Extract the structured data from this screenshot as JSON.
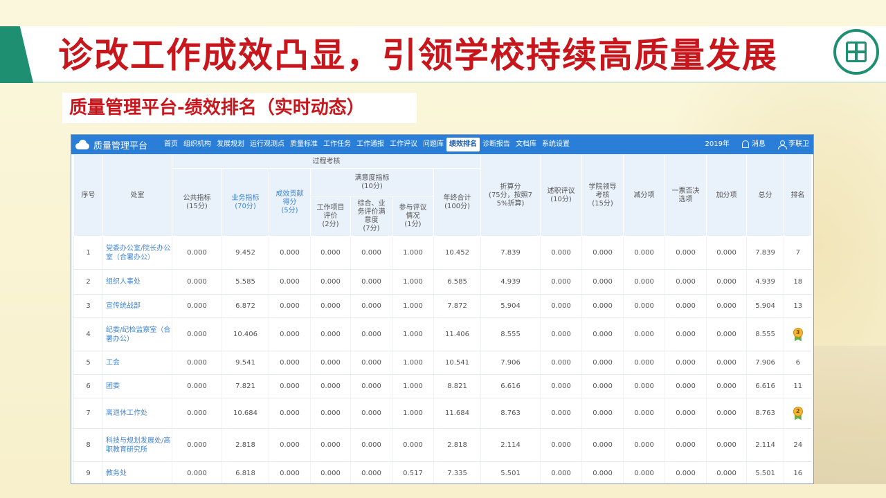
{
  "slide": {
    "title": "诊改工作成效凸显，引领学校持续高质量发展",
    "subtitle": "质量管理平台-绩效排名（实时动态）"
  },
  "app": {
    "brand": "质量管理平台",
    "nav": [
      "首页",
      "组织机构",
      "发展规划",
      "运行观测点",
      "质量标准",
      "工作任务",
      "工作通报",
      "工作评议",
      "问题库",
      "绩效排名",
      "诊断报告",
      "文档库",
      "系统设置"
    ],
    "nav_active": "绩效排名",
    "year": "2019年",
    "messages": "消息",
    "user": "李联卫"
  },
  "table": {
    "headers": {
      "index": "序号",
      "unit": "处室",
      "process": "过程考核",
      "public": "公共指标\n(15分)",
      "business": "业务指标\n(70分)",
      "contribution": "成效贡献\n得分\n(5分)",
      "satisfaction": "满意度指标\n(10分)",
      "sat_project": "工作项目\n评价\n(2分)",
      "sat_overall": "综合、业\n务评价满\n意度\n(7分)",
      "sat_participation": "参与评议\n情况\n(1分)",
      "annual_total": "年终合计\n(100分)",
      "converted": "折算分\n(75分，按照7\n5%折算)",
      "report": "述职评议\n(10分)",
      "leader": "学院领导\n考核\n(15分)",
      "deduction": "减分项",
      "veto": "一票否决\n选项",
      "bonus": "加分项",
      "total": "总分",
      "rank": "排名"
    },
    "rows": [
      {
        "idx": "1",
        "unit": "党委办公室/院长办公室（合署办公）",
        "public": "0.000",
        "business": "9.452",
        "contribution": "0.000",
        "sat_project": "0.000",
        "sat_overall": "0.000",
        "sat_participation": "1.000",
        "annual_total": "10.452",
        "converted": "7.839",
        "report": "0.000",
        "leader": "0.000",
        "deduction": "0.000",
        "veto": "0.000",
        "bonus": "0.000",
        "total": "7.839",
        "rank": "7"
      },
      {
        "idx": "2",
        "unit": "组织人事处",
        "public": "0.000",
        "business": "5.585",
        "contribution": "0.000",
        "sat_project": "0.000",
        "sat_overall": "0.000",
        "sat_participation": "1.000",
        "annual_total": "6.585",
        "converted": "4.939",
        "report": "0.000",
        "leader": "0.000",
        "deduction": "0.000",
        "veto": "0.000",
        "bonus": "0.000",
        "total": "4.939",
        "rank": "18"
      },
      {
        "idx": "3",
        "unit": "宣传统战部",
        "public": "0.000",
        "business": "6.872",
        "contribution": "0.000",
        "sat_project": "0.000",
        "sat_overall": "0.000",
        "sat_participation": "1.000",
        "annual_total": "7.872",
        "converted": "5.904",
        "report": "0.000",
        "leader": "0.000",
        "deduction": "0.000",
        "veto": "0.000",
        "bonus": "0.000",
        "total": "5.904",
        "rank": "13"
      },
      {
        "idx": "4",
        "unit": "纪委/纪检监察室（合署办公）",
        "public": "0.000",
        "business": "10.406",
        "contribution": "0.000",
        "sat_project": "0.000",
        "sat_overall": "0.000",
        "sat_participation": "1.000",
        "annual_total": "11.406",
        "converted": "8.555",
        "report": "0.000",
        "leader": "0.000",
        "deduction": "0.000",
        "veto": "0.000",
        "bonus": "0.000",
        "total": "8.555",
        "rank": "3",
        "medal": true
      },
      {
        "idx": "5",
        "unit": "工会",
        "public": "0.000",
        "business": "9.541",
        "contribution": "0.000",
        "sat_project": "0.000",
        "sat_overall": "0.000",
        "sat_participation": "1.000",
        "annual_total": "10.541",
        "converted": "7.906",
        "report": "0.000",
        "leader": "0.000",
        "deduction": "0.000",
        "veto": "0.000",
        "bonus": "0.000",
        "total": "7.906",
        "rank": "6"
      },
      {
        "idx": "6",
        "unit": "团委",
        "public": "0.000",
        "business": "7.821",
        "contribution": "0.000",
        "sat_project": "0.000",
        "sat_overall": "0.000",
        "sat_participation": "1.000",
        "annual_total": "8.821",
        "converted": "6.616",
        "report": "0.000",
        "leader": "0.000",
        "deduction": "0.000",
        "veto": "0.000",
        "bonus": "0.000",
        "total": "6.616",
        "rank": "11"
      },
      {
        "idx": "7",
        "unit": "离退休工作处",
        "public": "0.000",
        "business": "10.684",
        "contribution": "0.000",
        "sat_project": "0.000",
        "sat_overall": "0.000",
        "sat_participation": "1.000",
        "annual_total": "11.684",
        "converted": "8.763",
        "report": "0.000",
        "leader": "0.000",
        "deduction": "0.000",
        "veto": "0.000",
        "bonus": "0.000",
        "total": "8.763",
        "rank": "2",
        "medal": true
      },
      {
        "idx": "8",
        "unit": "科技与规划发展处/高职教育研究所",
        "public": "0.000",
        "business": "2.818",
        "contribution": "0.000",
        "sat_project": "0.000",
        "sat_overall": "0.000",
        "sat_participation": "0.000",
        "annual_total": "2.818",
        "converted": "2.114",
        "report": "0.000",
        "leader": "0.000",
        "deduction": "0.000",
        "veto": "0.000",
        "bonus": "0.000",
        "total": "2.114",
        "rank": "24"
      },
      {
        "idx": "9",
        "unit": "教务处",
        "public": "0.000",
        "business": "6.818",
        "contribution": "0.000",
        "sat_project": "0.000",
        "sat_overall": "0.000",
        "sat_participation": "0.517",
        "annual_total": "7.335",
        "converted": "5.501",
        "report": "0.000",
        "leader": "0.000",
        "deduction": "0.000",
        "veto": "0.000",
        "bonus": "0.000",
        "total": "5.501",
        "rank": "16"
      }
    ]
  },
  "colors": {
    "title_red": "#c8161d",
    "nav_blue": "#2a7ed8",
    "header_bg": "#e9f1fa",
    "link_blue": "#3e86d4",
    "accent_green": "#1f8f72"
  }
}
